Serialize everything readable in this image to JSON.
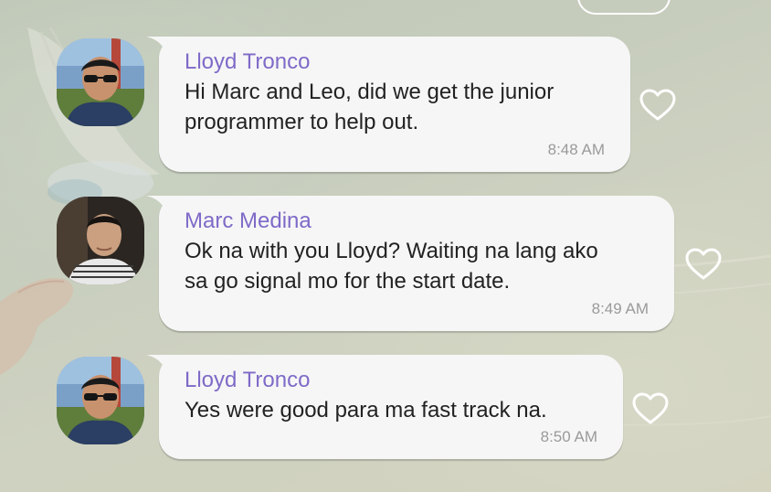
{
  "messages": [
    {
      "sender": "Lloyd Tronco",
      "lines": [
        "Hi Marc and Leo, did we get the junior",
        "programmer to help out."
      ],
      "time": "8:48 AM",
      "avatar_icon": "avatar-lloyd-icon",
      "like_icon": "heart-icon"
    },
    {
      "sender": "Marc Medina",
      "lines": [
        "Ok na with you Lloyd? Waiting na lang ako",
        "sa go signal mo for the start date."
      ],
      "time": "8:49 AM",
      "avatar_icon": "avatar-marc-icon",
      "like_icon": "heart-icon"
    },
    {
      "sender": "Lloyd Tronco",
      "lines": [
        "Yes were good para ma fast track na."
      ],
      "time": "8:50 AM",
      "avatar_icon": "avatar-lloyd-icon",
      "like_icon": "heart-icon"
    }
  ],
  "colors": {
    "sender_name": "#7f6ac8",
    "bubble": "#f6f6f6",
    "message_text": "#222222",
    "timestamp": "#9a9a9a",
    "heart_outline": "#ffffff"
  }
}
